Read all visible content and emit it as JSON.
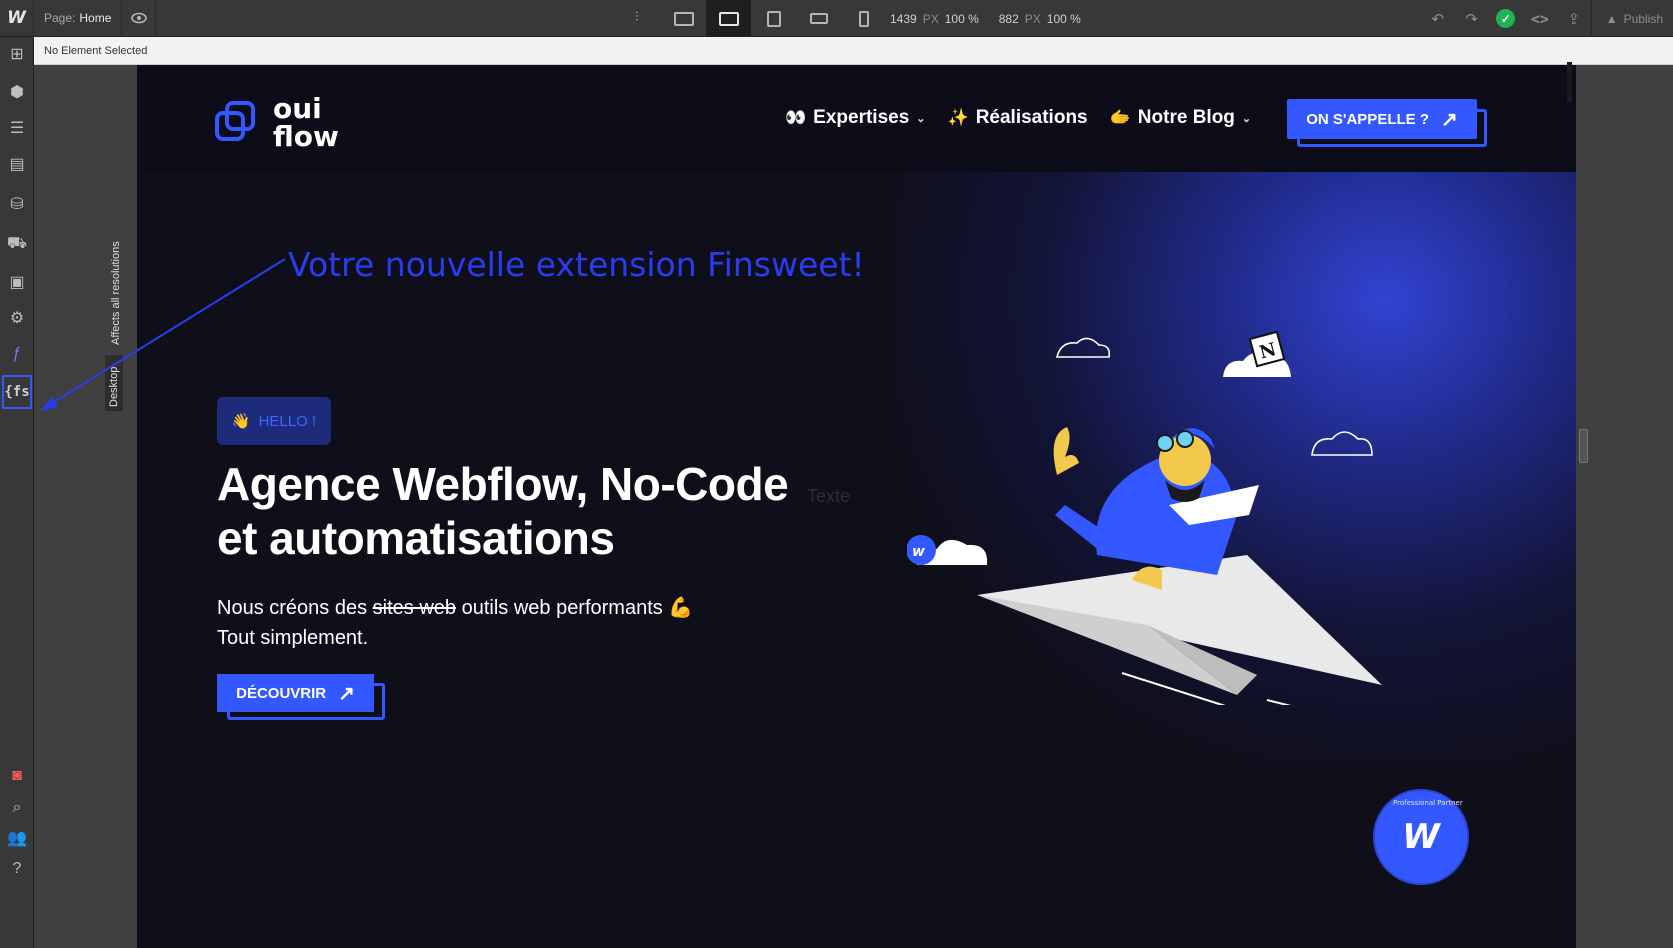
{
  "topbar": {
    "logo": "W",
    "page_key": "Page:",
    "page_value": "Home",
    "dims": {
      "width": "1439",
      "width_unit": "PX",
      "width_pct": "100 %",
      "height": "882",
      "height_unit": "PX",
      "height_pct": "100 %"
    },
    "publish_label": "Publish"
  },
  "selection_bar": {
    "text": "No Element Selected"
  },
  "canvas": {
    "affects_label": "Affects all resolutions",
    "breakpoint_tag": "Desktop"
  },
  "site": {
    "logo_line1": "oui",
    "logo_line2": "flow",
    "nav": [
      {
        "emoji": "👀",
        "label": "Expertises",
        "chevron": "⌄"
      },
      {
        "emoji": "✨",
        "label": "Réalisations",
        "chevron": ""
      },
      {
        "emoji": "🫱",
        "label": "Notre Blog",
        "chevron": "⌄"
      }
    ],
    "cta_label": "ON S'APPELLE ?",
    "annotation": "Votre nouvelle extension Finsweet!",
    "hello_emoji": "👋",
    "hello_label": "HELLO !",
    "title_line1": "Agence Webflow, No-Code",
    "title_line2": "et automatisations",
    "ghost_text": "Texte",
    "sub_prefix": "Nous créons des ",
    "sub_struck": "sites web",
    "sub_suffix": " outils web performants 💪",
    "sub_line2": "Tout simplement.",
    "discover_label": "DÉCOUVRIR",
    "badge_letter": "W",
    "badge_ring": "Professional Partner"
  },
  "colors": {
    "accent": "#3458ff",
    "site_bg": "#0f0f1a",
    "editor_bar": "#383838",
    "status_ok": "#1fb353"
  }
}
